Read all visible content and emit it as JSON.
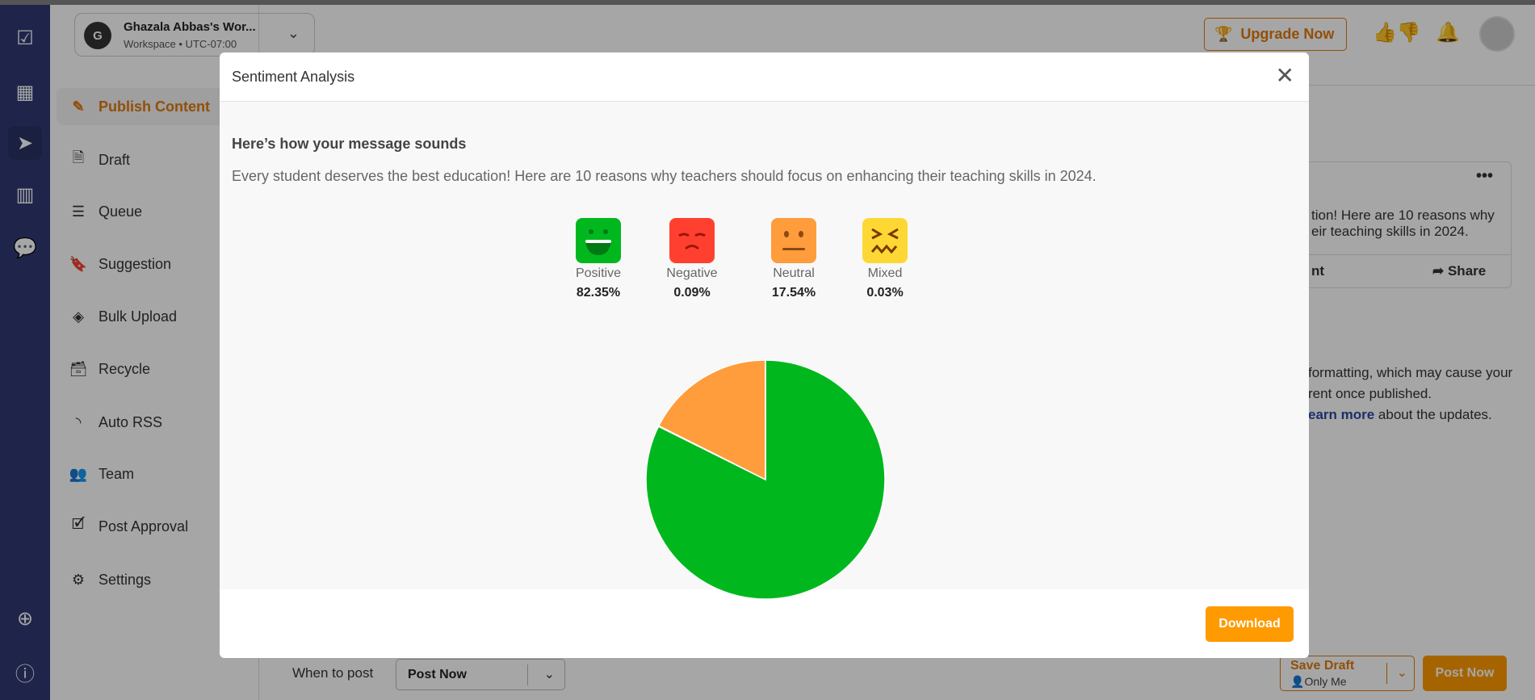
{
  "workspace": {
    "initial": "G",
    "name": "Ghazala Abbas's Wor...",
    "subtitle": "Workspace • UTC-07:00"
  },
  "rail": [
    "tasks-icon",
    "calendar-icon",
    "publish-icon",
    "analytics-icon",
    "chat-icon",
    "add-icon",
    "help-icon"
  ],
  "sidebar": {
    "items": [
      {
        "label": "Publish Content",
        "icon": "pencil-icon",
        "active": true
      },
      {
        "label": "Draft",
        "icon": "document-icon"
      },
      {
        "label": "Queue",
        "icon": "list-icon"
      },
      {
        "label": "Suggestion",
        "icon": "bookmark-icon"
      },
      {
        "label": "Bulk Upload",
        "icon": "layers-icon"
      },
      {
        "label": "Recycle",
        "icon": "archive-icon"
      },
      {
        "label": "Auto RSS",
        "icon": "rss-icon"
      },
      {
        "label": "Team",
        "icon": "team-icon"
      },
      {
        "label": "Post Approval",
        "icon": "approval-icon"
      },
      {
        "label": "Settings",
        "icon": "gear-icon"
      }
    ]
  },
  "header": {
    "upgrade": "Upgrade Now"
  },
  "background": {
    "preview_line1": "tion! Here are 10 reasons why",
    "preview_line2": "eir teaching skills in 2024.",
    "comment": "nt",
    "share": "Share",
    "notice1": "formatting, which may cause your",
    "notice2": "rent once published.",
    "learn_more": "earn more",
    "notice3": " about the updates."
  },
  "footer": {
    "when_label": "When to post",
    "when_value": "Post Now",
    "save_draft": "Save Draft",
    "visibility": "Only Me",
    "post_now": "Post Now"
  },
  "modal": {
    "title": "Sentiment Analysis",
    "heading": "Here’s how your message sounds",
    "message": "Every student deserves the best education! Here are 10 reasons why teachers should focus on enhancing their teaching skills in 2024.",
    "download": "Download"
  },
  "chart_data": {
    "type": "pie",
    "categories": [
      "Positive",
      "Negative",
      "Neutral",
      "Mixed"
    ],
    "values": [
      82.35,
      0.09,
      17.54,
      0.03
    ],
    "labels": [
      "82.35%",
      "0.09%",
      "17.54%",
      "0.03%"
    ],
    "colors": [
      "#00b81e",
      "#ff4030",
      "#ff9c3c",
      "#fdd835"
    ]
  }
}
